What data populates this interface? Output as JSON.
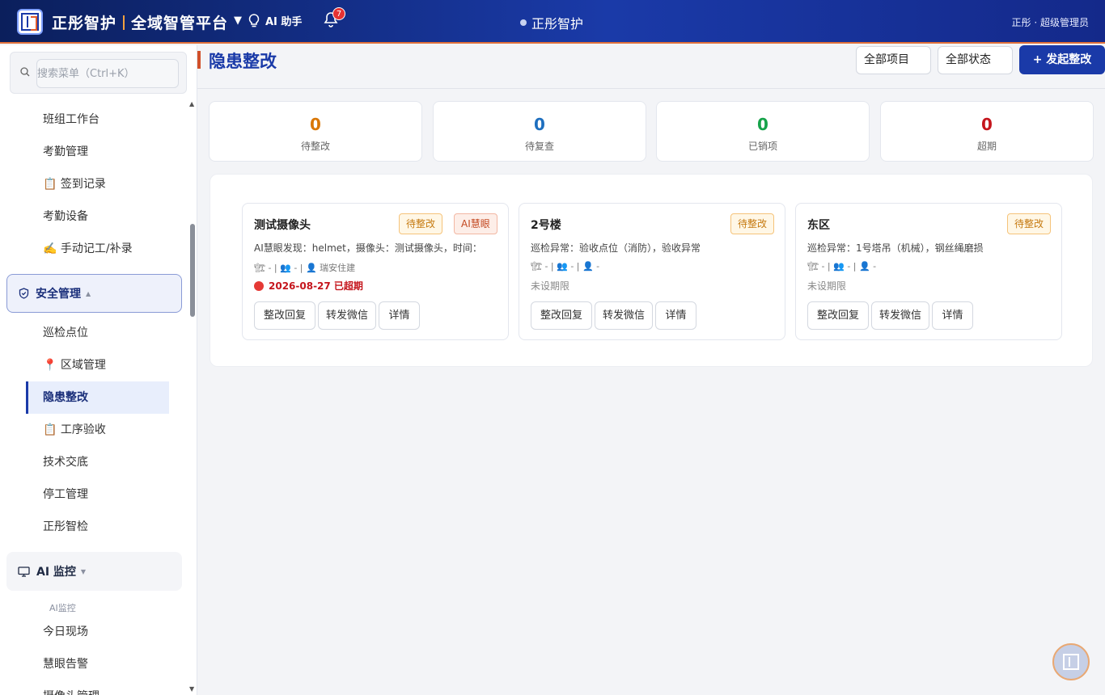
{
  "header": {
    "brand_name": "正彤智护",
    "platform_name": "全域智管平台",
    "caret": "▼",
    "ai_assistant": "AI 助手",
    "notification_count": "7",
    "center_title": "正彤智护",
    "user": "正彤 · 超级管理员"
  },
  "sidebar": {
    "search_placeholder": "搜索菜单（Ctrl+K）",
    "items": {
      "team_workbench": "班组工作台",
      "attendance": "考勤管理",
      "signin_records": "📋 签到记录",
      "attendance_devices": "考勤设备",
      "manual_records": "✍️ 手动记工/补录",
      "patrol_points": "巡检点位",
      "area_mgmt": "📍 区域管理",
      "hazard_rectify": "隐患整改",
      "process_acceptance": "📋 工序验收",
      "tech_briefing": "技术交底",
      "stop_work": "停工管理",
      "smart_inspection": "正彤智检",
      "today_site": "今日现场",
      "smart_alerts": "慧眼告警",
      "camera_mgmt": "摄像头管理"
    },
    "groups": {
      "safety": "安全管理",
      "ai_monitor": "AI 监控"
    },
    "group_arrows": {
      "safety": "▲",
      "ai_monitor": "▼"
    },
    "ai_sub_label": "AI监控"
  },
  "page": {
    "title": "隐患整改",
    "filter_project": "全部项目",
    "filter_status": "全部状态",
    "new_button": "+ 发起整改"
  },
  "stats": [
    {
      "value": "0",
      "label": "待整改",
      "color": "#d97706"
    },
    {
      "value": "0",
      "label": "待复查",
      "color": "#1e6fbf"
    },
    {
      "value": "0",
      "label": "已销项",
      "color": "#16a34a"
    },
    {
      "value": "0",
      "label": "超期",
      "color": "#c5161d"
    }
  ],
  "cards": [
    {
      "title": "测试摄像头",
      "tag_status": "待整改",
      "tag_ai": "AI慧眼",
      "desc": "AI慧眼发现：helmet，摄像头：测试摄像头，时间：",
      "meta": "🏗 - | 👥 - | 👤 瑞安住建",
      "due": "2026-08-27 已超期"
    },
    {
      "title": "2号楼",
      "tag_status": "待整改",
      "desc": "巡检异常：验收点位（消防），验收异常",
      "meta": "🏗 - | 👥 - | 👤 -",
      "due": "未设期限"
    },
    {
      "title": "东区",
      "tag_status": "待整改",
      "desc": "巡检异常：1号塔吊（机械），钢丝绳磨损",
      "meta": "🏗 - | 👥 - | 👤 -",
      "due": "未设期限"
    }
  ],
  "card_actions": {
    "reply": "整改回复",
    "forward": "转发微信",
    "detail": "详情"
  }
}
